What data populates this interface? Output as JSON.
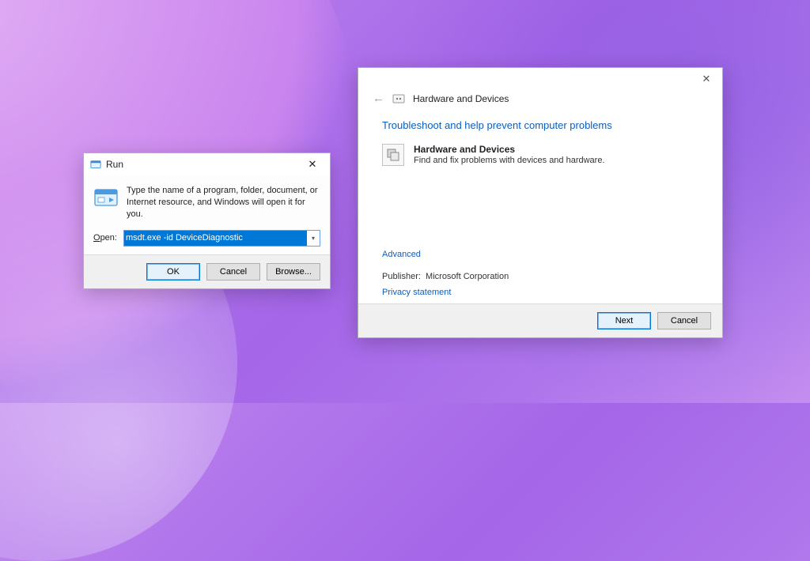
{
  "run": {
    "title": "Run",
    "description": "Type the name of a program, folder, document, or Internet resource, and Windows will open it for you.",
    "open_label": "Open:",
    "open_value": "msdt.exe -id DeviceDiagnostic",
    "buttons": {
      "ok": "OK",
      "cancel": "Cancel",
      "browse": "Browse..."
    }
  },
  "troubleshooter": {
    "breadcrumb": "Hardware and Devices",
    "heading": "Troubleshoot and help prevent computer problems",
    "item": {
      "title": "Hardware and Devices",
      "subtitle": "Find and fix problems with devices and hardware."
    },
    "advanced": "Advanced",
    "publisher_label": "Publisher:",
    "publisher_value": "Microsoft Corporation",
    "privacy": "Privacy statement",
    "buttons": {
      "next": "Next",
      "cancel": "Cancel"
    }
  }
}
